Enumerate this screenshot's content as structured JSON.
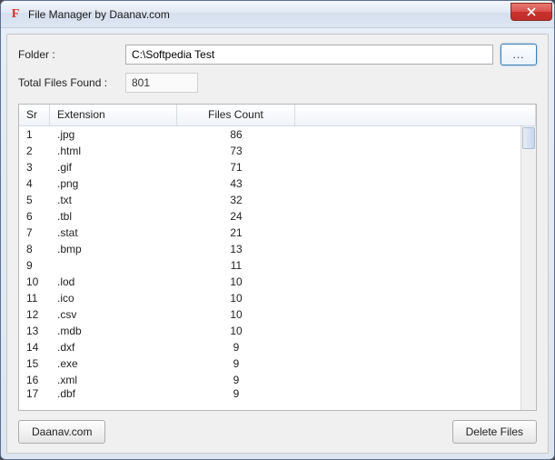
{
  "window": {
    "title": "File Manager by Daanav.com"
  },
  "form": {
    "folder_label": "Folder :",
    "folder_value": "C:\\Softpedia Test",
    "browse_label": "...",
    "total_label": "Total Files Found :",
    "total_value": "801"
  },
  "columns": {
    "sr": "Sr",
    "ext": "Extension",
    "cnt": "Files Count"
  },
  "rows": [
    {
      "sr": "1",
      "ext": ".jpg",
      "cnt": "86"
    },
    {
      "sr": "2",
      "ext": ".html",
      "cnt": "73"
    },
    {
      "sr": "3",
      "ext": ".gif",
      "cnt": "71"
    },
    {
      "sr": "4",
      "ext": ".png",
      "cnt": "43"
    },
    {
      "sr": "5",
      "ext": ".txt",
      "cnt": "32"
    },
    {
      "sr": "6",
      "ext": ".tbl",
      "cnt": "24"
    },
    {
      "sr": "7",
      "ext": ".stat",
      "cnt": "21"
    },
    {
      "sr": "8",
      "ext": ".bmp",
      "cnt": "13"
    },
    {
      "sr": "9",
      "ext": "",
      "cnt": "11"
    },
    {
      "sr": "10",
      "ext": ".lod",
      "cnt": "10"
    },
    {
      "sr": "11",
      "ext": ".ico",
      "cnt": "10"
    },
    {
      "sr": "12",
      "ext": ".csv",
      "cnt": "10"
    },
    {
      "sr": "13",
      "ext": ".mdb",
      "cnt": "10"
    },
    {
      "sr": "14",
      "ext": ".dxf",
      "cnt": "9"
    },
    {
      "sr": "15",
      "ext": ".exe",
      "cnt": "9"
    },
    {
      "sr": "16",
      "ext": ".xml",
      "cnt": "9"
    },
    {
      "sr": "17",
      "ext": ".dbf",
      "cnt": "9"
    }
  ],
  "footer": {
    "daanav": "Daanav.com",
    "delete": "Delete Files"
  }
}
